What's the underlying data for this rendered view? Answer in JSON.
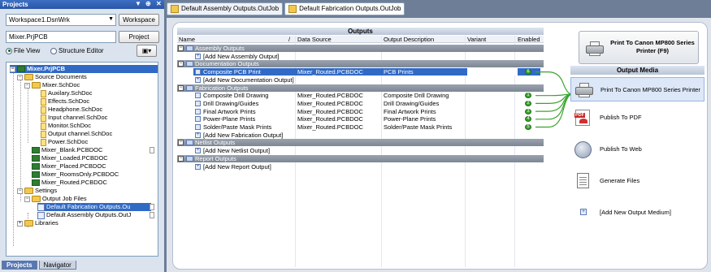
{
  "projects_panel": {
    "title": "Projects",
    "workspace": "Workspace1.DsnWrk",
    "workspace_button": "Workspace",
    "project": "Mixer.PrjPCB",
    "project_button": "Project",
    "view_file": "File View",
    "view_structure": "Structure Editor",
    "tree": [
      "Mixer.PrjPCB",
      "Source Documents",
      "Mixer.SchDoc",
      "Auxilary.SchDoc",
      "Effects.SchDoc",
      "Headphone.SchDoc",
      "Input channel.SchDoc",
      "Monitor.SchDoc",
      "Output channel.SchDoc",
      "Power.SchDoc",
      "Mixer_Blank.PCBDOC",
      "Mixer_Loaded.PCBDOC",
      "Mixer_Placed.PCBDOC",
      "Mixer_RoomsOnly.PCBDOC",
      "Mixer_Routed.PCBDOC",
      "Settings",
      "Output Job Files",
      "Default Fabrication Outputs.Ou",
      "Default Assembly Outputs.OutJ",
      "Libraries"
    ],
    "tabs": [
      "Projects",
      "Navigator"
    ]
  },
  "doc_tabs": [
    "Default Assembly Outputs.OutJob",
    "Default Fabrication Outputs.OutJob"
  ],
  "outputs": {
    "header": "Outputs",
    "columns": {
      "name": "Name",
      "data_source": "Data Source",
      "description": "Output Description",
      "variant": "Variant",
      "enabled": "Enabled"
    },
    "rows": [
      {
        "kind": "group",
        "name": "Assembly Outputs"
      },
      {
        "kind": "add",
        "name": "[Add New Assembly Output]"
      },
      {
        "kind": "group",
        "name": "Documentation Outputs"
      },
      {
        "kind": "item",
        "name": "Composite PCB Print",
        "source": "Mixer_Routed.PCBDOC",
        "desc": "PCB Prints",
        "pin": "6",
        "selected": true
      },
      {
        "kind": "add",
        "name": "[Add New Documentation Output]"
      },
      {
        "kind": "group",
        "name": "Fabrication Outputs"
      },
      {
        "kind": "item",
        "name": "Composite Drill Drawing",
        "source": "Mixer_Routed.PCBDOC",
        "desc": "Composite Drill Drawing",
        "pin": "1"
      },
      {
        "kind": "item",
        "name": "Drill Drawing/Guides",
        "source": "Mixer_Routed.PCBDOC",
        "desc": "Drill Drawing/Guides",
        "pin": "2"
      },
      {
        "kind": "item",
        "name": "Final Artwork Prints",
        "source": "Mixer_Routed.PCBDOC",
        "desc": "Final Artwork Prints",
        "pin": "3"
      },
      {
        "kind": "item",
        "name": "Power-Plane Prints",
        "source": "Mixer_Routed.PCBDOC",
        "desc": "Power-Plane Prints",
        "pin": "4"
      },
      {
        "kind": "item",
        "name": "Solder/Paste Mask Prints",
        "source": "Mixer_Routed.PCBDOC",
        "desc": "Solder/Paste Mask Prints",
        "pin": "5"
      },
      {
        "kind": "add",
        "name": "[Add New Fabrication Output]"
      },
      {
        "kind": "group",
        "name": "Netlist Outputs"
      },
      {
        "kind": "add",
        "name": "[Add New Netlist Output]"
      },
      {
        "kind": "group",
        "name": "Report Outputs"
      },
      {
        "kind": "add",
        "name": "[Add New Report Output]"
      }
    ]
  },
  "print_button": "Print To Canon MP800 Series Printer (F9)",
  "media": {
    "header": "Output Media",
    "items": [
      {
        "label": "Print To Canon MP800 Series Printer",
        "icon": "printer-icon"
      },
      {
        "label": "Publish To PDF",
        "icon": "pdf-icon"
      },
      {
        "label": "Publish To Web",
        "icon": "globe-icon"
      },
      {
        "label": "Generate Files",
        "icon": "files-icon"
      },
      {
        "label": "[Add New Output Medium]",
        "icon": "add-icon"
      }
    ]
  },
  "colors": {
    "selection": "#316ac5",
    "group_header": "#8a939e",
    "link_wire": "#3aa42e"
  }
}
